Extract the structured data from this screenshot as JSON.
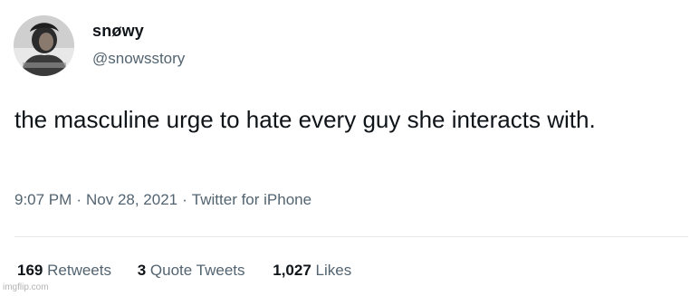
{
  "author": {
    "display_name": "snøwy",
    "handle": "@snowsstory",
    "avatar_icon": "profile-avatar"
  },
  "tweet": {
    "text": "the masculine urge to hate every guy she interacts with."
  },
  "meta": {
    "time": "9:07 PM",
    "separator": "·",
    "date": "Nov 28, 2021",
    "source": "Twitter for iPhone"
  },
  "stats": {
    "retweets_count": "169",
    "retweets_label": "Retweets",
    "quote_tweets_count": "3",
    "quote_tweets_label": "Quote Tweets",
    "likes_count": "1,027",
    "likes_label": "Likes"
  },
  "watermark": "imgflip.com",
  "colors": {
    "text_primary": "#0f1419",
    "text_secondary": "#536471",
    "divider": "#e6e9eb"
  }
}
